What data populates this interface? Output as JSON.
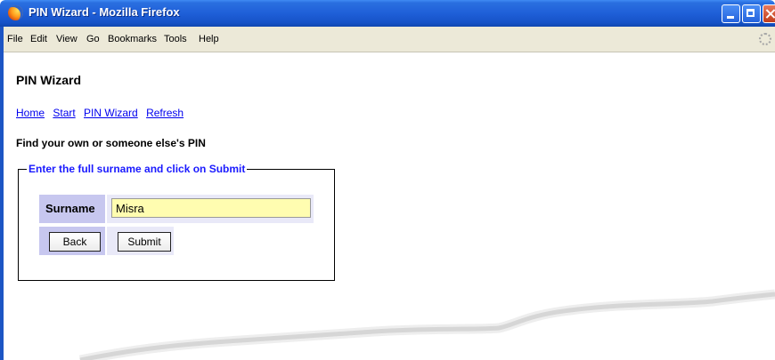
{
  "window": {
    "title": "PIN Wizard - Mozilla Firefox"
  },
  "menu": {
    "items": [
      "File",
      "Edit",
      "View",
      "Go",
      "Bookmarks",
      "Tools",
      "Help"
    ]
  },
  "page": {
    "title": "PIN Wizard",
    "links": [
      "Home",
      "Start",
      "PIN Wizard",
      "Refresh"
    ],
    "subheading": "Find your own or someone else's PIN"
  },
  "form": {
    "legend": "Enter the full surname and click on Submit",
    "surname_label": "Surname",
    "surname_value": "Misra",
    "back_label": "Back",
    "submit_label": "Submit"
  },
  "colors": {
    "titlebar": "#1f5fd8",
    "link": "#0000ee",
    "legend": "#1a1aff",
    "input_bg": "#fffdb0",
    "label_cell_bg": "#c7c7ef"
  }
}
